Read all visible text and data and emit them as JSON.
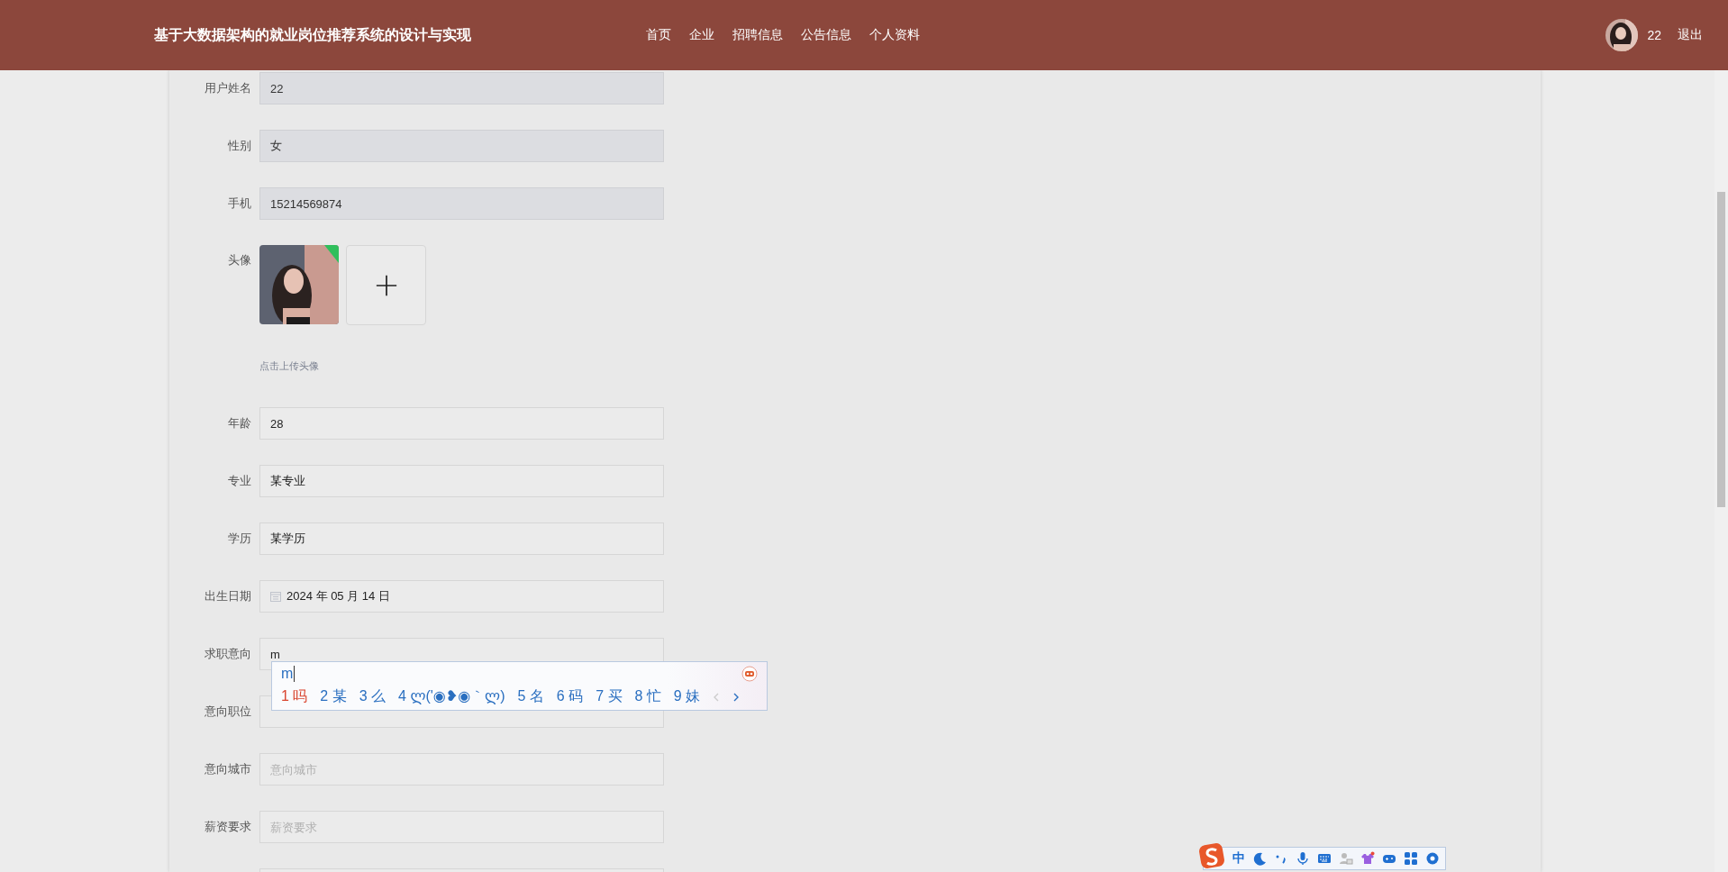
{
  "header": {
    "brand": "基于大数据架构的就业岗位推荐系统的设计与实现",
    "nav": [
      {
        "label": "首页"
      },
      {
        "label": "企业"
      },
      {
        "label": "招聘信息"
      },
      {
        "label": "公告信息"
      },
      {
        "label": "个人资料"
      }
    ],
    "user": {
      "name": "22",
      "logout": "退出"
    }
  },
  "form": {
    "fields": [
      {
        "kind": "input",
        "label": "用户姓名",
        "value": "22",
        "disabled": true
      },
      {
        "kind": "input",
        "label": "性别",
        "value": "女",
        "disabled": true
      },
      {
        "kind": "input",
        "label": "手机",
        "value": "15214569874",
        "disabled": true
      },
      {
        "kind": "upload",
        "label": "头像",
        "hint": "点击上传头像"
      },
      {
        "kind": "input",
        "label": "年龄",
        "value": "28",
        "disabled": false
      },
      {
        "kind": "input",
        "label": "专业",
        "value": "某专业",
        "disabled": false
      },
      {
        "kind": "input",
        "label": "学历",
        "value": "某学历",
        "disabled": false
      },
      {
        "kind": "date",
        "label": "出生日期",
        "value": "2024 年 05 月 14 日"
      },
      {
        "kind": "input",
        "label": "求职意向",
        "value": "m",
        "disabled": false
      },
      {
        "kind": "select",
        "label": "意向职位"
      },
      {
        "kind": "input",
        "label": "意向城市",
        "placeholder": "意向城市",
        "disabled": false
      },
      {
        "kind": "input",
        "label": "薪资要求",
        "placeholder": "薪资要求",
        "disabled": false
      },
      {
        "kind": "input",
        "disabled": false
      }
    ]
  },
  "ime": {
    "composition": "m",
    "candidates": [
      {
        "index": "1",
        "text": "吗",
        "selected": true
      },
      {
        "index": "2",
        "text": "某",
        "selected": false
      },
      {
        "index": "3",
        "text": "么",
        "selected": false
      },
      {
        "index": "4",
        "text": "ლ('◉❥◉｀ლ)",
        "selected": false
      },
      {
        "index": "5",
        "text": "名",
        "selected": false
      },
      {
        "index": "6",
        "text": "码",
        "selected": false
      },
      {
        "index": "7",
        "text": "买",
        "selected": false
      },
      {
        "index": "8",
        "text": "忙",
        "selected": false
      },
      {
        "index": "9",
        "text": "妹",
        "selected": false
      }
    ],
    "toolbar": {
      "language": "中"
    }
  }
}
